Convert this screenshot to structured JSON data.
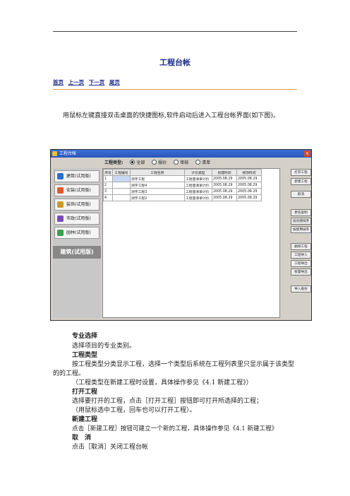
{
  "page": {
    "title": "工程台帐",
    "nav": [
      "首页",
      "上一页",
      "下一页",
      "尾页"
    ],
    "intro": "用鼠标左键直接双击桌面的快捷图标,软件启动后进入工程台帐界面(如下图)。"
  },
  "app": {
    "window_title": "工程台帐",
    "type_label": "工程类型:",
    "radios": [
      {
        "label": "全部",
        "checked": true
      },
      {
        "label": "报价",
        "checked": false
      },
      {
        "label": "审核",
        "checked": false
      },
      {
        "label": "清单",
        "checked": false
      }
    ],
    "side_items": [
      {
        "label": "建筑(试用版)",
        "color": "#2a6fc8"
      },
      {
        "label": "安装(试用版)",
        "color": "#e05a2a"
      },
      {
        "label": "装饰(试用版)",
        "color": "#c89a2a"
      },
      {
        "label": "市政(试用版)",
        "color": "#7a4ab8"
      },
      {
        "label": "园林(试用版)",
        "color": "#3aa04a"
      }
    ],
    "side_current": "建筑(试用版)",
    "columns": [
      "序号",
      "工程编号",
      "工程名称",
      "计价类型",
      "创建时间",
      "修改时间"
    ],
    "rows": [
      [
        "1",
        "",
        "测字工程",
        "工程量清单计价",
        "2005.08.29",
        "2005.08.29"
      ],
      [
        "2",
        "",
        "测字工程4",
        "工程量清单计价",
        "2005.08.29",
        "2005.08.29"
      ],
      [
        "3",
        "",
        "测字工程3",
        "工程量清单计价",
        "2005.08.29",
        "2005.08.29"
      ],
      [
        "4",
        "",
        "测字工程2",
        "工程量清单计价",
        "2005.08.29",
        "2005.08.29"
      ]
    ],
    "buttons": [
      "打开工程",
      "新建工程",
      "取消",
      "更名复制",
      "按创建排序",
      "按使用排序",
      "删除工程",
      "工程导入",
      "工程导出",
      "拆量导出",
      "导入备份"
    ]
  },
  "sections": {
    "s1_heading": "专业选择",
    "s1_text": "选择项目的专业类别。",
    "s2_heading": "工程类型",
    "s2_text": "按工程类型分类显示工程，选择一个类型后系统在工程列表里只显示属于该类型的的工程。",
    "s2_note": "（工程类型在新建工程时设置，具体操作参见《4.1 新建工程》）",
    "s3_heading": "打开工程",
    "s3_text": "选择要打开的工程，点击［打开工程］按钮即可打开所选择的工程；",
    "s3_note": "（用鼠标选中工程，回车也可以打开工程）。",
    "s4_heading": "新建工程",
    "s4_text": "点击［新建工程］按钮可建立一个新的工程，具体操作参见《4.1 新建工程》",
    "s5_heading": "取　消",
    "s5_text": "点击［取消］关闭工程台帐"
  }
}
